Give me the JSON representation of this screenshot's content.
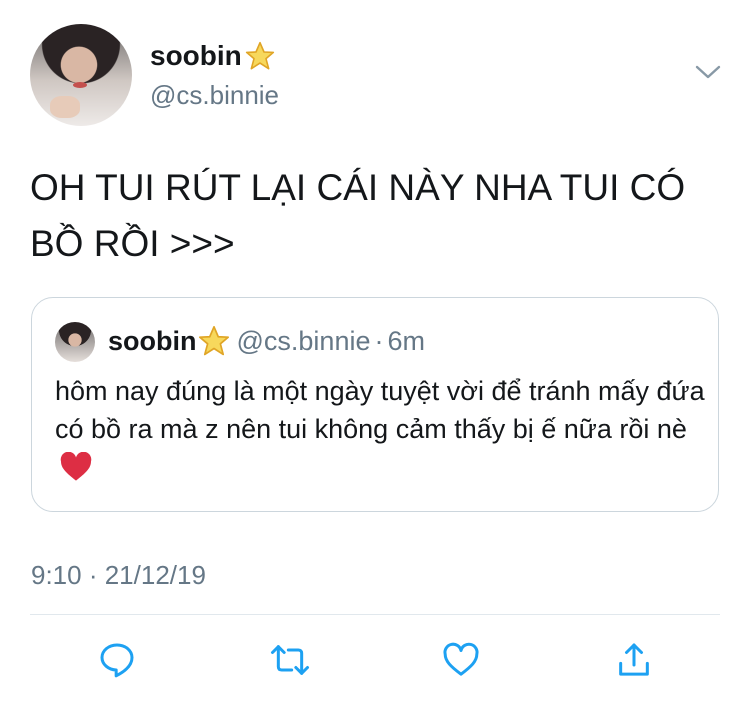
{
  "author": {
    "name": "soobin",
    "handle": "@cs.binnie",
    "badge_icon": "star-emoji"
  },
  "tweet": {
    "text": "OH TUI RÚT LẠI CÁI NÀY NHA TUI CÓ BỒ RỒI >>>",
    "timestamp": "9:10 · 21/12/19"
  },
  "quoted_tweet": {
    "name": "soobin",
    "handle": "@cs.binnie",
    "separator": "·",
    "time": "6m",
    "text": "hôm nay đúng là một ngày tuyệt vời để tránh mấy đứa có bồ ra mà z nên tui không cảm thấy bị ế nữa rồi nè",
    "trailing_emoji": "❤️"
  },
  "actions": [
    "reply-icon",
    "retweet-icon",
    "like-icon",
    "share-icon"
  ],
  "colors": {
    "text": "#14171a",
    "secondary": "#657786",
    "border": "#ccd6dd",
    "icon": "#1da1f2",
    "star": "#f5c842",
    "heart": "#dd2e44"
  }
}
